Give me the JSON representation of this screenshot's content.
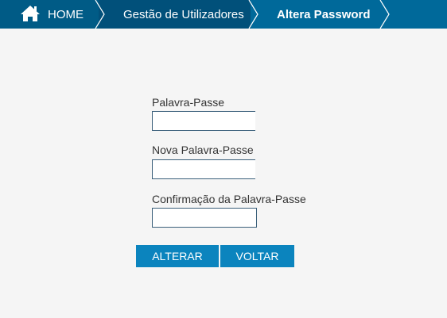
{
  "breadcrumb": {
    "home_label": "HOME",
    "items": [
      {
        "label": "Gestão de Utilizadores"
      },
      {
        "label": "Altera Password"
      }
    ]
  },
  "form": {
    "current_password_label": "Palavra-Passe",
    "current_password_value": "",
    "new_password_label": "Nova Palavra-Passe",
    "new_password_value": "",
    "confirm_password_label": "Confirmação da Palavra-Passe",
    "confirm_password_value": ""
  },
  "buttons": {
    "change_label": "ALTERAR",
    "back_label": "VOLTAR"
  },
  "colors": {
    "header_bg": "#005b86",
    "active_crumb_bg": "#00699a",
    "button_bg": "#0b84be",
    "page_bg": "#f5f5f5"
  }
}
